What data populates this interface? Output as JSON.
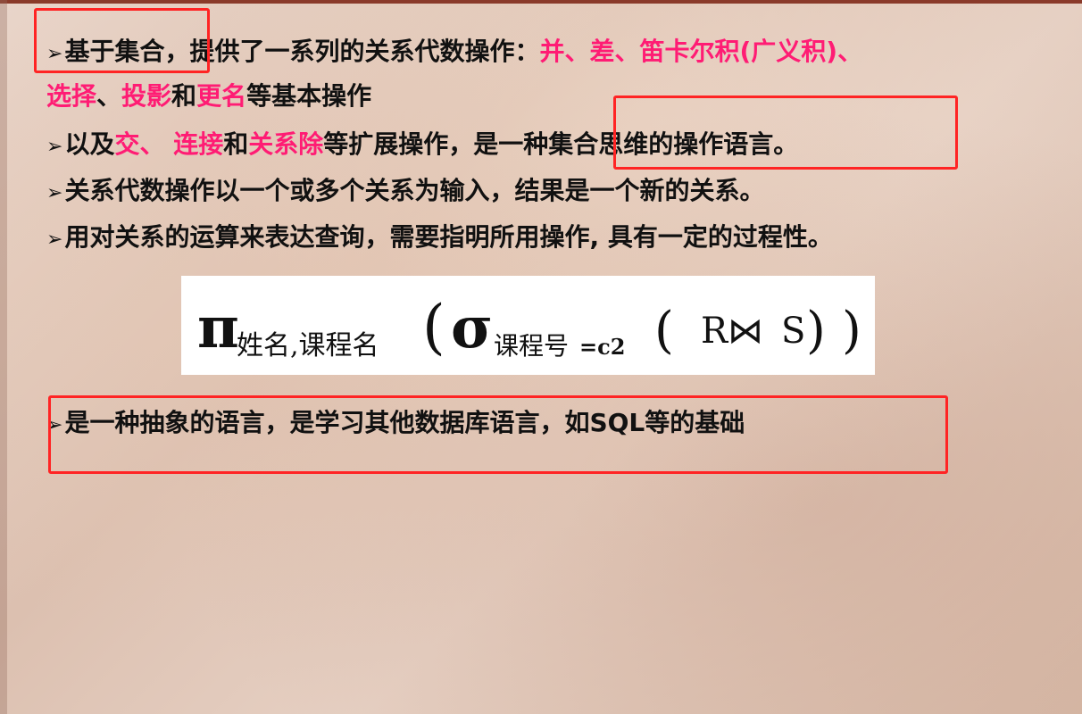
{
  "line1": {
    "bullet": "➢",
    "prefix": "基于集合",
    "mid": "，提供了一系列的关系代数操作：",
    "ops": "并、差、笛卡尔积(广义积)、"
  },
  "line2": {
    "op1": "选择",
    "sep1": "、",
    "op2": "投影",
    "mid": "和",
    "op3": "更名",
    "tail": "等基本操作"
  },
  "line3": {
    "bullet": "➢",
    "prefix": "以及",
    "op1": "交、 连接",
    "mid": "和",
    "op2": "关系除",
    "tail": "等扩展操作，是一种集合思维的操作语言。"
  },
  "line4": {
    "bullet": "➢",
    "text": "关系代数操作以一个或多个关系为输入，结果是一个新的关系。"
  },
  "line5": {
    "bullet": "➢",
    "text": "用对关系的运算来表达查询，需要指明所用操作, 具有一定的过程性。"
  },
  "formula": {
    "pi": "π",
    "pi_sub": "姓名,课程名",
    "open1": "(",
    "sigma": "σ",
    "sigma_sub_cn": "课程号",
    "sigma_sub_eq": "=c2",
    "open2": "(",
    "r": "R",
    "join": "⋈",
    "s": "S",
    "close2": ")",
    "close1": ")"
  },
  "line6": {
    "bullet": "➢",
    "text": "是一种抽象的语言，是学习其他数据库语言，如SQL等的基础"
  },
  "colors": {
    "highlight": "#ff1c74",
    "box": "#ff2424",
    "text": "#111111"
  }
}
